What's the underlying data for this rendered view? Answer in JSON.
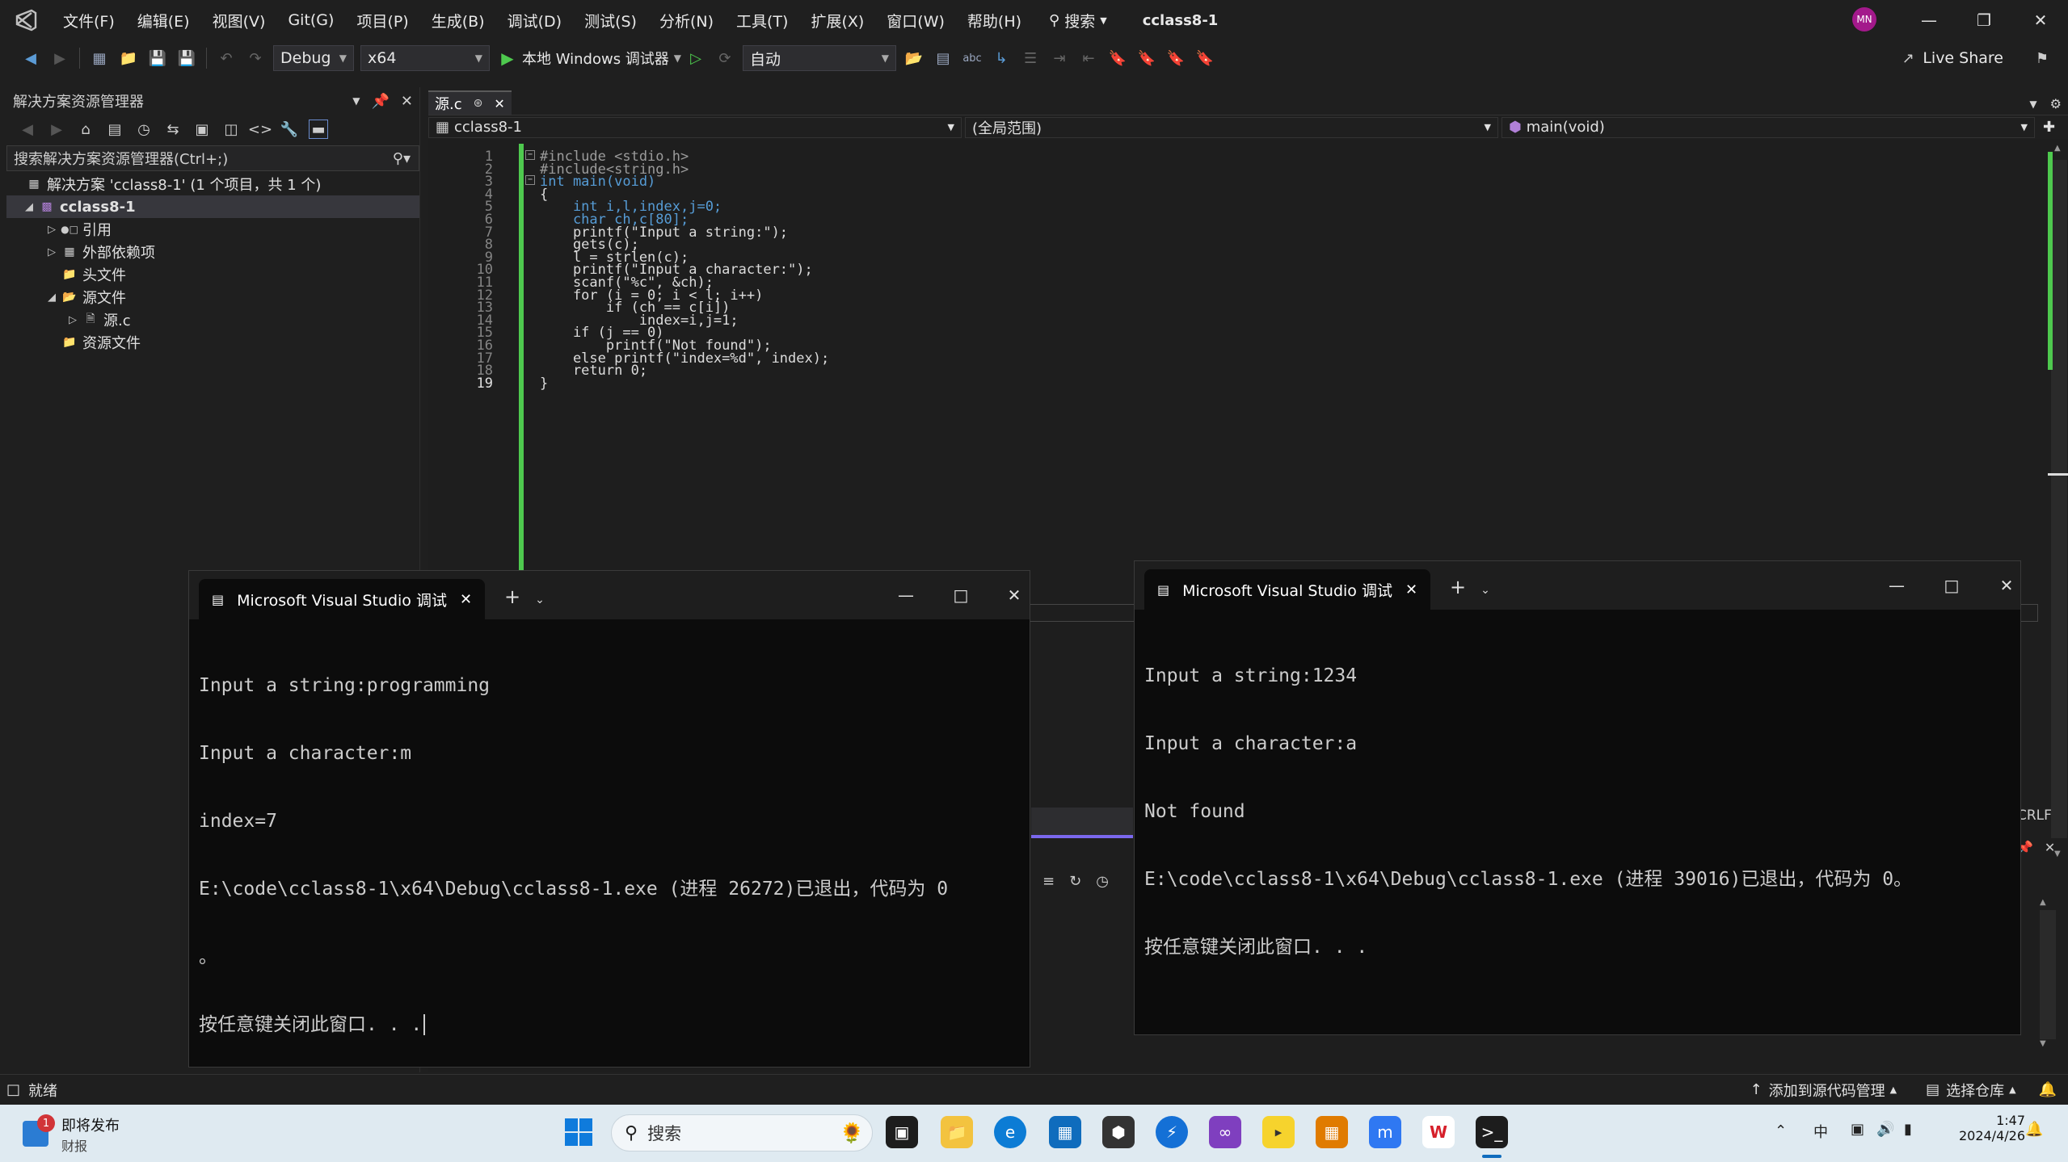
{
  "menubar": {
    "items": [
      "文件(F)",
      "编辑(E)",
      "视图(V)",
      "Git(G)",
      "项目(P)",
      "生成(B)",
      "调试(D)",
      "测试(S)",
      "分析(N)",
      "工具(T)",
      "扩展(X)",
      "窗口(W)",
      "帮助(H)"
    ],
    "search_label": "搜索",
    "project_title": "cclass8-1",
    "avatar_initials": "MN"
  },
  "toolbar": {
    "config": "Debug",
    "platform": "x64",
    "run_label": "本地 Windows 调试器",
    "auto_combo": "自动",
    "live_share": "Live Share"
  },
  "solution_explorer": {
    "title": "解决方案资源管理器",
    "search_placeholder": "搜索解决方案资源管理器(Ctrl+;)",
    "solution_label": "解决方案 'cclass8-1' (1 个项目，共 1 个)",
    "project": "cclass8-1",
    "nodes": [
      "引用",
      "外部依赖项",
      "头文件",
      "源文件",
      "源.c",
      "资源文件"
    ]
  },
  "editor": {
    "tab_name": "源.c",
    "nav_project": "cclass8-1",
    "nav_scope": "(全局范围)",
    "nav_member": "main(void)",
    "line_numbers": [
      "1",
      "2",
      "3",
      "4",
      "5",
      "6",
      "7",
      "8",
      "9",
      "10",
      "11",
      "12",
      "13",
      "14",
      "15",
      "16",
      "17",
      "18",
      "19"
    ],
    "lines": [
      "#include <stdio.h>",
      "#include<string.h>",
      "int main(void)",
      "{",
      "    int i,l,index,j=0;",
      "    char ch,c[80];",
      "    printf(\"Input a string:\");",
      "    gets(c);",
      "    l = strlen(c);",
      "    printf(\"Input a character:\");",
      "    scanf(\"%c\", &ch);",
      "    for (i = 0; i < l; i++)",
      "        if (ch == c[i])",
      "            index=i,j=1;",
      "    if (j == 0)",
      "        printf(\"Not found\");",
      "    else printf(\"index=%d\", index);",
      "    return 0;",
      "}"
    ]
  },
  "console1": {
    "title": "Microsoft Visual Studio 调试",
    "lines": [
      "Input a string:programming",
      "Input a character:m",
      "index=7",
      "E:\\code\\cclass8-1\\x64\\Debug\\cclass8-1.exe (进程 26272)已退出，代码为 0",
      "。",
      "按任意键关闭此窗口. . ."
    ]
  },
  "console2": {
    "title": "Microsoft Visual Studio 调试",
    "lines": [
      "Input a string:1234",
      "Input a character:a",
      "Not found",
      "E:\\code\\cclass8-1\\x64\\Debug\\cclass8-1.exe (进程 39016)已退出，代码为 0。",
      "按任意键关闭此窗口. . ."
    ]
  },
  "statusbar": {
    "ready": "就绪",
    "add_source": "添加到源代码管理",
    "select_repo": "选择仓库",
    "crlf": "CRLF"
  },
  "taskbar": {
    "news_title": "即将发布",
    "news_sub": "财报",
    "news_badge": "1",
    "search_label": "搜索",
    "time": "1:47",
    "date": "2024/4/26",
    "ime": "中"
  }
}
